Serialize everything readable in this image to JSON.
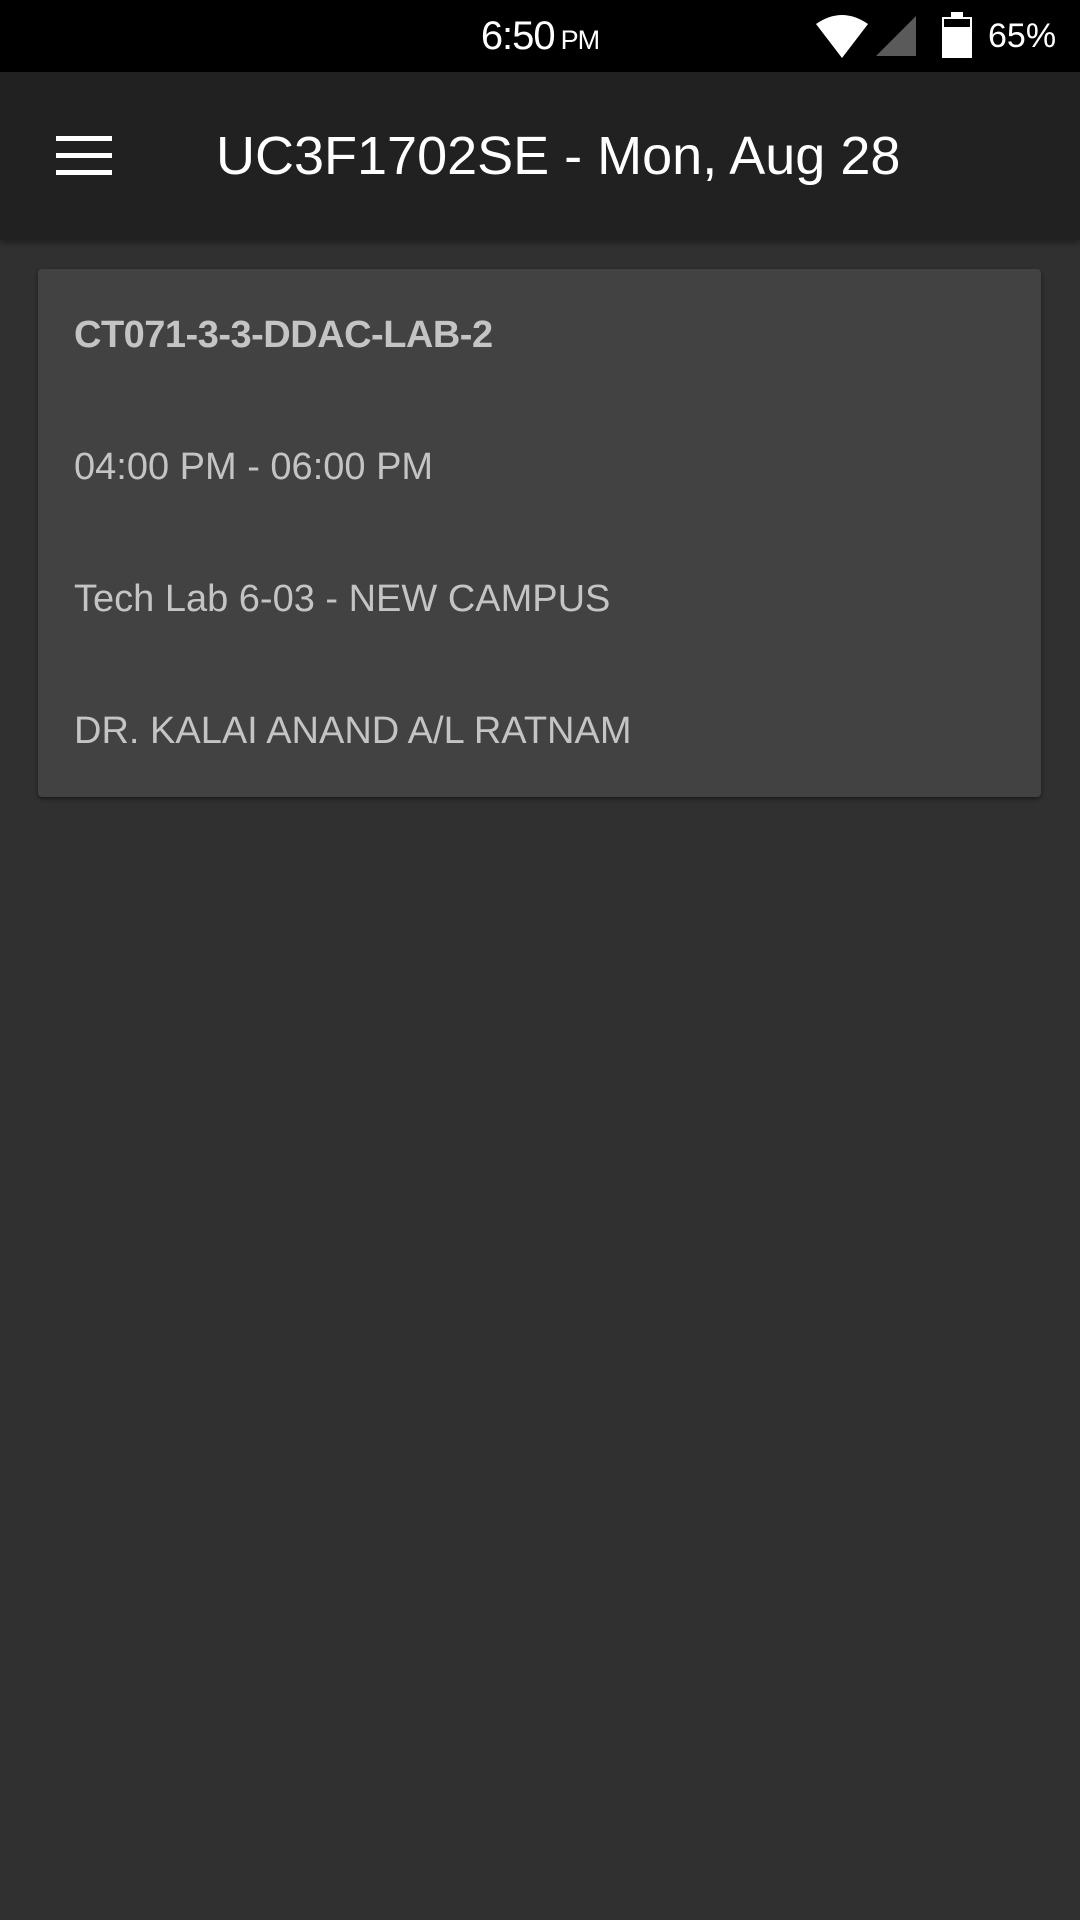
{
  "status_bar": {
    "time": "6:50",
    "ampm": "PM",
    "battery_percent": "65%",
    "icons": [
      "wifi-icon",
      "cell-signal-icon",
      "battery-icon"
    ]
  },
  "app_bar": {
    "menu_icon": "hamburger-menu-icon",
    "title": "UC3F1702SE - Mon, Aug 28"
  },
  "classes": [
    {
      "code": "CT071-3-3-DDAC-LAB-2",
      "time": "04:00 PM - 06:00 PM",
      "room": "Tech Lab 6-03 - NEW CAMPUS",
      "lecturer": "DR. KALAI ANAND A/L RATNAM"
    }
  ],
  "colors": {
    "status_bar_bg": "#000000",
    "app_bar_bg": "#212121",
    "page_bg": "#303030",
    "card_bg": "#424242",
    "card_text": "#c4c4c4"
  }
}
